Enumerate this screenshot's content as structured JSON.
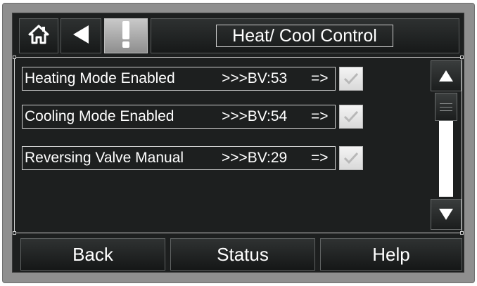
{
  "header": {
    "title": "Heat/ Cool Control",
    "icons": [
      "home-icon",
      "back-arrow-icon",
      "alert-exclamation-icon"
    ]
  },
  "rows": [
    {
      "label": "Heating Mode Enabled",
      "ref": ">>>BV:53",
      "arrow": "=>",
      "checked": true
    },
    {
      "label": "Cooling Mode Enabled",
      "ref": ">>>BV:54",
      "arrow": "=>",
      "checked": true
    },
    {
      "label": "Reversing Valve Manual",
      "ref": ">>>BV:29",
      "arrow": "=>",
      "checked": true
    }
  ],
  "scrollbar": {
    "icons": [
      "scroll-up-icon",
      "scroll-down-icon"
    ]
  },
  "footer": {
    "back_label": "Back",
    "status_label": "Status",
    "help_label": "Help"
  },
  "colors": {
    "screen_bg": "#1d1f1f",
    "bezel": "#8f8f8f",
    "text": "#ffffff",
    "alert_button": "#b5b5b5"
  }
}
